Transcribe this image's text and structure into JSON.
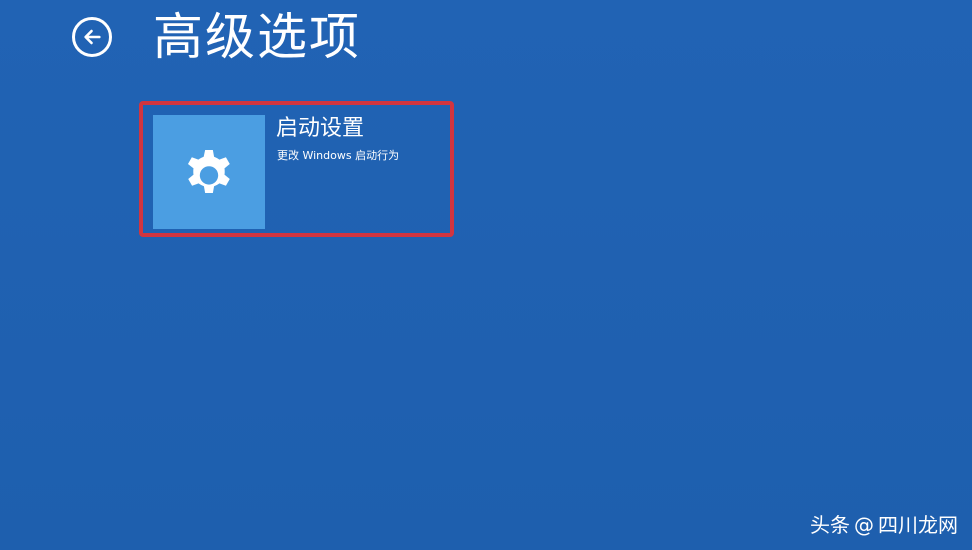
{
  "header": {
    "title": "高级选项",
    "back_icon": "back-arrow-icon"
  },
  "options": [
    {
      "title": "启动设置",
      "description": "更改 Windows 启动行为",
      "icon": "gear-icon"
    }
  ],
  "watermark": {
    "platform": "头条",
    "handle": "@",
    "site": "四川龙网"
  },
  "colors": {
    "background": "#1f5fb0",
    "tile": "#4b9ee2",
    "highlight_border": "#d13540",
    "text": "#ffffff"
  }
}
